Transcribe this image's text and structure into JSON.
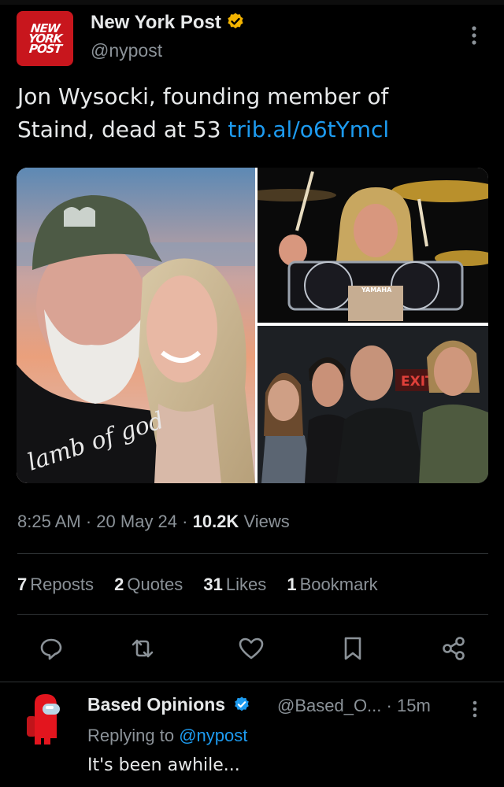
{
  "account": {
    "logo_lines": [
      "NEW",
      "YORK",
      "POST"
    ],
    "name": "New York Post",
    "handle": "@nypost"
  },
  "tweet": {
    "text_line1": "Jon Wysocki, founding member of",
    "text_line2": "Staind, dead at 53 ",
    "link": "trib.al/o6tYmcl",
    "image_captions": {
      "shirt_text": "lamb of god",
      "drum_brand": "YAMAHA",
      "exit_sign": "EXIT"
    },
    "time": "8:25 AM",
    "date": "20 May 24",
    "views_count": "10.2K",
    "views_label": "Views",
    "sep": "·"
  },
  "stats": [
    {
      "count": "7",
      "label": "Reposts"
    },
    {
      "count": "2",
      "label": "Quotes"
    },
    {
      "count": "31",
      "label": "Likes"
    },
    {
      "count": "1",
      "label": "Bookmark"
    }
  ],
  "actions": [
    "reply-icon",
    "repost-icon",
    "like-icon",
    "bookmark-icon",
    "share-icon"
  ],
  "reply": {
    "name": "Based Opinions",
    "handle": "@Based_O...",
    "time": "· 15m",
    "replying_prefix": "Replying to ",
    "replying_handle": "@nypost",
    "text": "It's been awhile..."
  },
  "colors": {
    "background": "#000000",
    "text": "#e7e9ea",
    "secondary": "#8b9298",
    "link": "#1d9bf0",
    "gold_badge": "#f4b400",
    "blue_badge": "#1d9bf0",
    "brand_red": "#c8161d"
  }
}
